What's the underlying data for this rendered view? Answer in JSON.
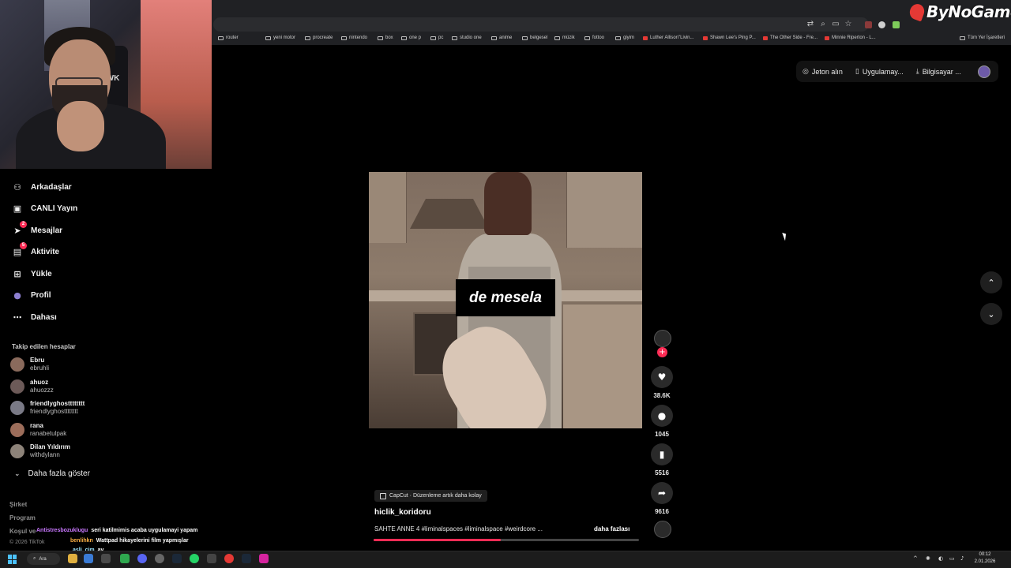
{
  "brand": {
    "logo_text": "ByNoGame"
  },
  "bookmarks": [
    {
      "label": "router",
      "icon": "folder-icon"
    },
    {
      "label": "yeni motor",
      "icon": "folder-icon"
    },
    {
      "label": "procreate",
      "icon": "folder-icon"
    },
    {
      "label": "nintendo",
      "icon": "folder-icon"
    },
    {
      "label": "box",
      "icon": "folder-icon"
    },
    {
      "label": "one p",
      "icon": "folder-icon"
    },
    {
      "label": "pc",
      "icon": "folder-icon"
    },
    {
      "label": "studio one",
      "icon": "folder-icon"
    },
    {
      "label": "anime",
      "icon": "folder-icon"
    },
    {
      "label": "belgesel",
      "icon": "folder-icon"
    },
    {
      "label": "müzik",
      "icon": "folder-icon"
    },
    {
      "label": "fottoo",
      "icon": "folder-icon"
    },
    {
      "label": "giyim",
      "icon": "folder-icon"
    },
    {
      "label": "Luther Allison\"Livin...",
      "icon": "youtube-icon"
    },
    {
      "label": "Shawn Lee's Ping P...",
      "icon": "youtube-icon"
    },
    {
      "label": "The Other Side - Fre...",
      "icon": "youtube-icon"
    },
    {
      "label": "Minnie Riperton - L...",
      "icon": "youtube-icon"
    },
    {
      "label": "Tüm Yer İşaretleri",
      "icon": "folder-icon"
    }
  ],
  "top_actions": {
    "coins": "Jeton alın",
    "app": "Uygulamay...",
    "computer": "Bilgisayar ..."
  },
  "webcam": {
    "chair_text": "AWK"
  },
  "sidebar": {
    "items": [
      {
        "label": "Arkadaşlar",
        "icon": "friends-icon"
      },
      {
        "label": "CANLI Yayın",
        "icon": "live-icon"
      },
      {
        "label": "Mesajlar",
        "icon": "messages-icon",
        "badge": "2"
      },
      {
        "label": "Aktivite",
        "icon": "activity-icon",
        "badge": "5"
      },
      {
        "label": "Yükle",
        "icon": "upload-icon"
      },
      {
        "label": "Profil",
        "icon": "profile-icon"
      },
      {
        "label": "Dahası",
        "icon": "more-icon"
      }
    ],
    "following_title": "Takip edilen hesaplar",
    "accounts": [
      {
        "name": "Ebru",
        "username": "ebruhli"
      },
      {
        "name": "ahuoz",
        "username": "ahuozzz"
      },
      {
        "name": "friendlyghostttttttt",
        "username": "friendlyghostttttttt"
      },
      {
        "name": "rana",
        "username": "ranabetulpak"
      },
      {
        "name": "Dilan Yıldırım",
        "username": "withdylann"
      }
    ],
    "show_more": "Daha fazla göster",
    "footer": {
      "company": "Şirket",
      "program": "Program",
      "terms": "Koşul ve",
      "copyright": "© 2026 TikTok"
    }
  },
  "chat": [
    {
      "user": "Antistresbozuklugu",
      "message": "seri katilmimis acaba uygulamayi yapam",
      "color": "#c978ff"
    },
    {
      "user": "benlihkn",
      "message": "Wattpad hikayelerini film yapmışlar",
      "color": "#ffb347"
    },
    {
      "user": "asli_cim",
      "message": "ay",
      "color": "#9ee6ff"
    }
  ],
  "video": {
    "caption_overlay": "de mesela",
    "capcut_label": "CapCut · Düzenleme artık daha kolay",
    "author": "hiclik_koridoru",
    "description": "SAHTE ANNE 4 #liminalspaces #liminalspace #weirdcore ...",
    "more": "daha fazlası",
    "progress": 0.48
  },
  "actions": {
    "likes": "38.6K",
    "comments": "1045",
    "saves": "5516",
    "shares": "9616"
  },
  "taskbar": {
    "search": "Ara",
    "time": "00:12",
    "date": "2.01.2026"
  }
}
